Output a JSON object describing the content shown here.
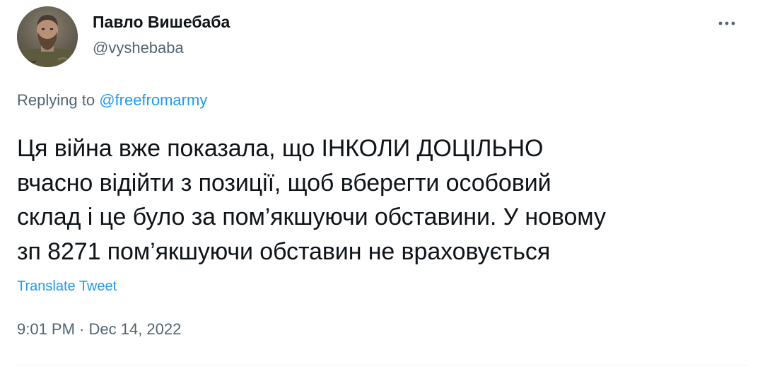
{
  "author": {
    "display_name": "Павло Вишебаба",
    "handle": "@vyshebaba",
    "avatar": "profile-photo"
  },
  "reply": {
    "prefix": "Replying to ",
    "mention": "@freefromarmy"
  },
  "tweet": {
    "lines": [
      "Ця війна вже показала, що ІНКОЛИ ДОЦІЛЬНО",
      "вчасно відійти з позиції, щоб вберегти особовий",
      "склад і це було за пом’якшуючи обставини. У новому",
      "зп 8271 пом’якшуючи обставин не враховується"
    ],
    "translate_label": "Translate Tweet"
  },
  "meta": {
    "time": "9:01 PM",
    "separator": " · ",
    "date": "Dec 14, 2022"
  },
  "icons": {
    "more": "more-horizontal-icon"
  },
  "colors": {
    "text_primary": "#0f1419",
    "text_secondary": "#536471",
    "accent": "#1d9bf0",
    "divider": "#eff3f4"
  }
}
